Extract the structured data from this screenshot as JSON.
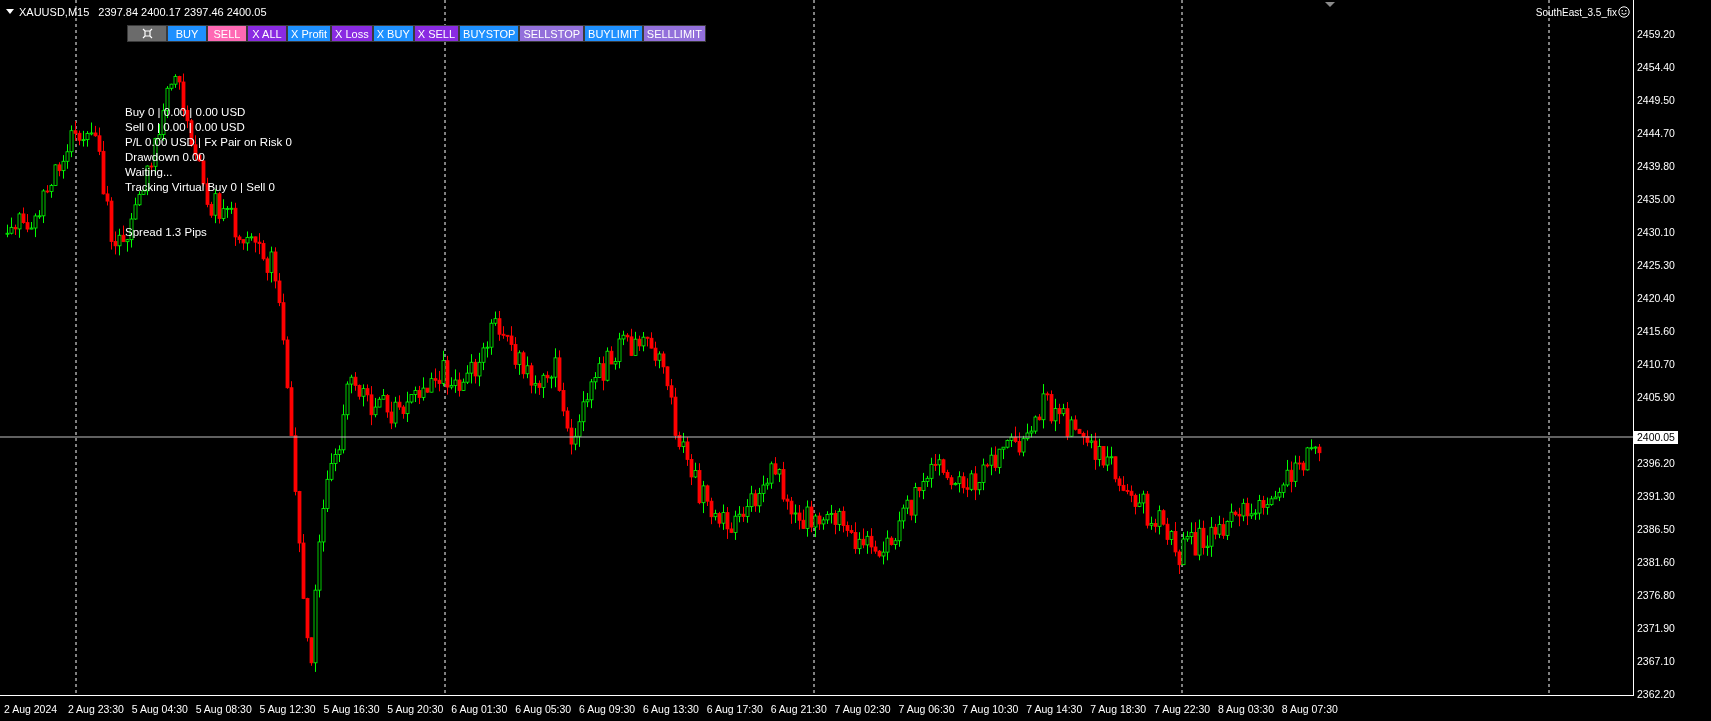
{
  "chart_header": {
    "symbol": "XAUUSD,M15",
    "ohlc": "2397.84 2400.17 2397.46 2400.05"
  },
  "toolbar": [
    {
      "kind": "icon",
      "color": "#6b6b6b"
    },
    {
      "kind": "text",
      "label": "BUY",
      "color": "#1e90ff"
    },
    {
      "kind": "text",
      "label": "SELL",
      "color": "#ff69b4"
    },
    {
      "kind": "text",
      "label": "X ALL",
      "color": "#8a2be2"
    },
    {
      "kind": "text",
      "label": "X Profit",
      "color": "#1e90ff"
    },
    {
      "kind": "text",
      "label": "X Loss",
      "color": "#8a2be2"
    },
    {
      "kind": "text",
      "label": "X BUY",
      "color": "#1e90ff"
    },
    {
      "kind": "text",
      "label": "X SELL",
      "color": "#8a2be2"
    },
    {
      "kind": "text",
      "label": "BUYSTOP",
      "color": "#1e90ff"
    },
    {
      "kind": "text",
      "label": "SELLSTOP",
      "color": "#9370db"
    },
    {
      "kind": "text",
      "label": "BUYLIMIT",
      "color": "#1e90ff"
    },
    {
      "kind": "text",
      "label": "SELLLIMIT",
      "color": "#9370db"
    }
  ],
  "info_lines": [
    "Buy 0 | 0.00 | 0.00 USD",
    "Sell 0 | 0.00 | 0.00 USD",
    "P/L 0.00 USD | Fx Pair on Risk 0",
    "Drawdown 0.00",
    "Waiting...",
    "Tracking Virtual Buy 0 | Sell 0"
  ],
  "spread": "Spread 1.3 Pips",
  "expert": {
    "name": "SouthEast_3.5_fix"
  },
  "price_axis": [
    "2459.20",
    "2454.40",
    "2449.50",
    "2444.70",
    "2439.80",
    "2435.00",
    "2430.10",
    "2425.30",
    "2420.40",
    "2415.60",
    "2410.70",
    "2405.90",
    "2396.20",
    "2391.30",
    "2386.50",
    "2381.60",
    "2376.80",
    "2371.90",
    "2367.10",
    "2362.20"
  ],
  "current_price": "2400.05",
  "time_axis": [
    "2 Aug 2024",
    "2 Aug 23:30",
    "5 Aug 04:30",
    "5 Aug 08:30",
    "5 Aug 12:30",
    "5 Aug 16:30",
    "5 Aug 20:30",
    "6 Aug 01:30",
    "6 Aug 05:30",
    "6 Aug 09:30",
    "6 Aug 13:30",
    "6 Aug 17:30",
    "6 Aug 21:30",
    "7 Aug 02:30",
    "7 Aug 06:30",
    "7 Aug 10:30",
    "7 Aug 14:30",
    "7 Aug 18:30",
    "7 Aug 22:30",
    "8 Aug 03:30",
    "8 Aug 07:30"
  ]
}
